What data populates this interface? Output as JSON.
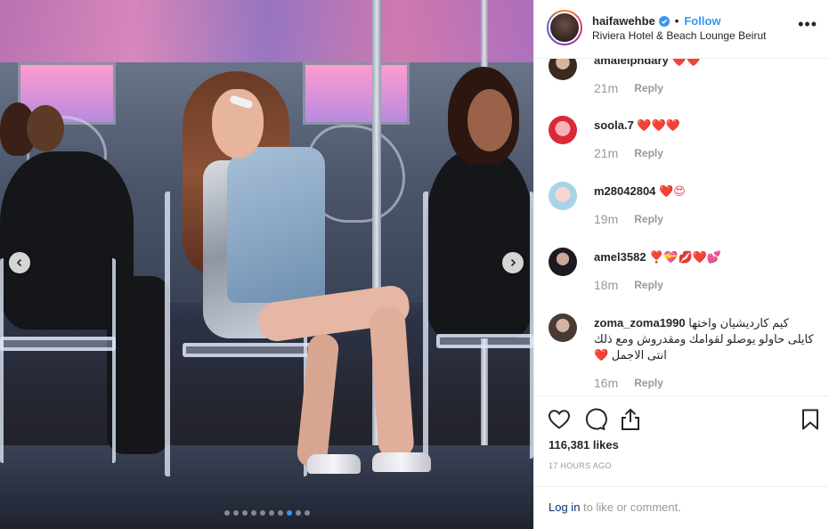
{
  "post": {
    "username": "haifawehbe",
    "separator": "•",
    "follow_label": "Follow",
    "location": "Riviera Hotel & Beach Lounge Beirut",
    "more_label": "•••"
  },
  "comments": [
    {
      "username": "amalelphdary",
      "text": "❤️❤️",
      "time": "21m",
      "reply": "Reply"
    },
    {
      "username": "soola.7",
      "text": "❤️❤️❤️",
      "time": "21m",
      "reply": "Reply"
    },
    {
      "username": "m28042804",
      "text": "❤️😍",
      "time": "19m",
      "reply": "Reply"
    },
    {
      "username": "amel3582",
      "text": "❣️💝💋❤️💕",
      "time": "18m",
      "reply": "Reply"
    },
    {
      "username": "zoma_zoma1990",
      "text": "كيم كارديشيان واختها كايلى حاولو يوصلو لقوامك ومقدروش ومع ذلك انتى الاجمل ❤️",
      "time": "16m",
      "reply": "Reply"
    }
  ],
  "stats": {
    "likes": "116,381 likes",
    "time_ago": "17 HOURS AGO"
  },
  "footer": {
    "login_link": "Log in",
    "login_rest": " to like or comment."
  },
  "carousel": {
    "dots": 10,
    "active_index": 7
  },
  "colors": {
    "accent": "#3897f0",
    "heart": "#ed4956",
    "muted": "#999999"
  }
}
